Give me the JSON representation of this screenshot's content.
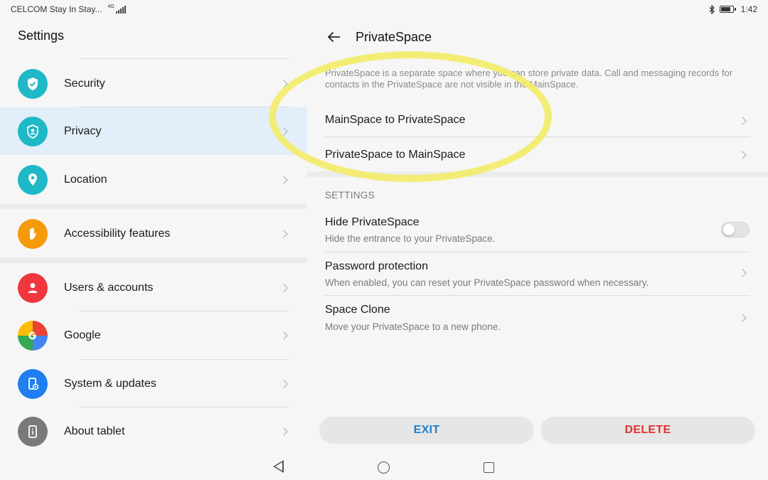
{
  "status_bar": {
    "carrier": "CELCOM Stay In Stay...",
    "network": "4G",
    "time": "1:42"
  },
  "left_pane": {
    "title": "Settings",
    "items": [
      {
        "label": "Security",
        "icon": "shield-check-icon",
        "color": "#1fb8c6"
      },
      {
        "label": "Privacy",
        "icon": "privacy-shield-icon",
        "color": "#1fb8c6",
        "selected": true
      },
      {
        "label": "Location",
        "icon": "location-pin-icon",
        "color": "#1fb8c6"
      },
      {
        "label": "Accessibility features",
        "icon": "hand-icon",
        "color": "#f59a0b"
      },
      {
        "label": "Users & accounts",
        "icon": "user-icon",
        "color": "#f0373d"
      },
      {
        "label": "Google",
        "icon": "google-icon",
        "color": "#4285f4"
      },
      {
        "label": "System & updates",
        "icon": "phone-gear-icon",
        "color": "#1f7ff0"
      },
      {
        "label": "About tablet",
        "icon": "tablet-info-icon",
        "color": "#7a7a7a"
      }
    ]
  },
  "right_pane": {
    "title": "PrivateSpace",
    "description": "PrivateSpace is a separate space where you can store private data. Call and messaging records for contacts in the PrivateSpace are not visible in the MainSpace.",
    "actions": [
      {
        "label": "MainSpace to PrivateSpace"
      },
      {
        "label": "PrivateSpace to MainSpace"
      }
    ],
    "settings_header": "SETTINGS",
    "settings": [
      {
        "title": "Hide PrivateSpace",
        "subtitle": "Hide the entrance to your PrivateSpace.",
        "control": "toggle",
        "enabled": false
      },
      {
        "title": "Password protection",
        "subtitle": "When enabled, you can reset your PrivateSpace password when necessary.",
        "control": "chevron"
      },
      {
        "title": "Space Clone",
        "subtitle": "Move your PrivateSpace to a new phone.",
        "control": "chevron"
      }
    ],
    "exit_label": "EXIT",
    "delete_label": "DELETE"
  },
  "colors": {
    "accent_blue": "#1a7fd4",
    "delete_red": "#e03030",
    "selected_bg": "#e2eef9",
    "highlight_yellow": "#f2ec6a"
  }
}
